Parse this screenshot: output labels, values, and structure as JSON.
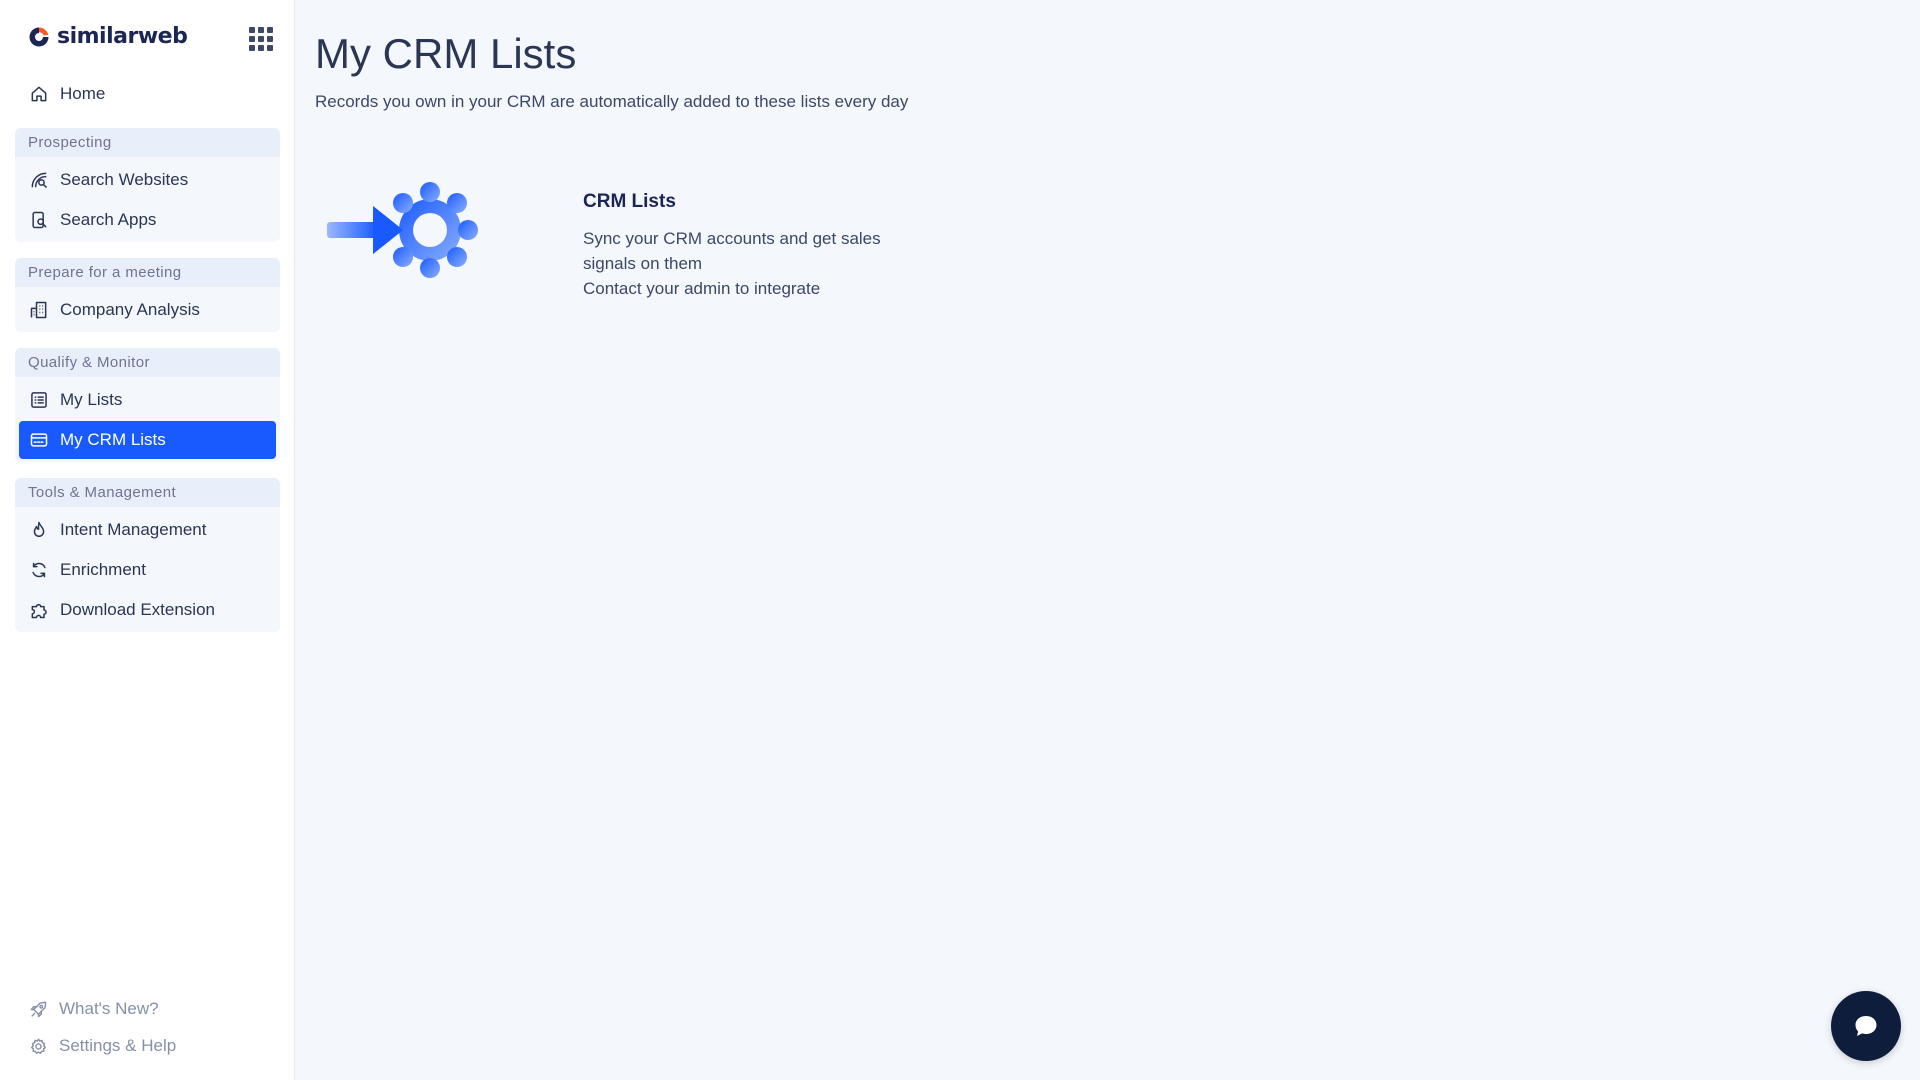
{
  "brand": {
    "name": "similarweb"
  },
  "nav": {
    "home": "Home",
    "groups": [
      {
        "label": "Prospecting",
        "items": [
          "Search Websites",
          "Search Apps"
        ]
      },
      {
        "label": "Prepare for a meeting",
        "items": [
          "Company Analysis"
        ]
      },
      {
        "label": "Qualify & Monitor",
        "items": [
          "My Lists",
          "My CRM Lists"
        ]
      },
      {
        "label": "Tools & Management",
        "items": [
          "Intent Management",
          "Enrichment",
          "Download Extension"
        ]
      }
    ],
    "active_item": "My CRM Lists"
  },
  "footer": {
    "whats_new": "What's New?",
    "settings": "Settings & Help"
  },
  "main": {
    "title": "My CRM Lists",
    "subtitle": "Records you own in your CRM are automatically added to these lists every day",
    "card": {
      "title": "CRM Lists",
      "line1": "Sync your CRM accounts and get sales",
      "line2": "signals on them",
      "line3": "Contact your admin to integrate"
    }
  },
  "icons": {
    "brand": "similarweb-logo-icon",
    "apps": "apps-grid-icon",
    "home": "home-icon",
    "search_websites": "search-websites-icon",
    "search_apps": "search-apps-icon",
    "company": "building-icon",
    "my_lists": "list-icon",
    "crm_lists": "crm-card-icon",
    "intent": "flame-icon",
    "enrichment": "refresh-icon",
    "extension": "puzzle-icon",
    "whats_new": "rocket-icon",
    "settings": "gear-icon",
    "chat": "chat-bubble-icon"
  },
  "colors": {
    "accent": "#195afe",
    "sidebar_bg": "#ffffff",
    "page_bg": "#f4f7fc",
    "group_label_bg": "#e9effa",
    "text_primary": "#1b2653",
    "chat_button": "#0f1d3d",
    "brand_orange": "#ff5a1f"
  }
}
